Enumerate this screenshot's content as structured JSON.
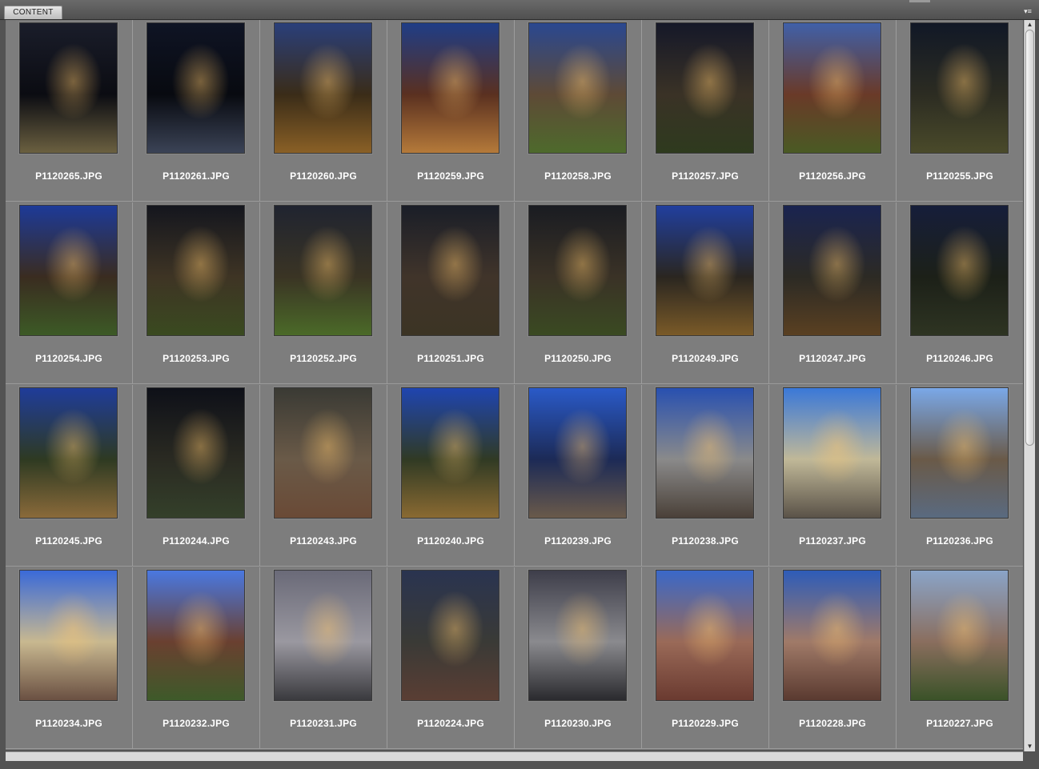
{
  "panel": {
    "tab_label": "CONTENT",
    "menu_icon": "panel-menu-icon"
  },
  "rows": [
    [
      {
        "name": "P1120265.JPG",
        "palette": [
          "#1a1d2a",
          "#0b0c12",
          "#6b6040"
        ]
      },
      {
        "name": "P1120261.JPG",
        "palette": [
          "#0f1424",
          "#080a10",
          "#3b4356"
        ]
      },
      {
        "name": "P1120260.JPG",
        "palette": [
          "#2a3f7a",
          "#3a2c18",
          "#8a6026"
        ]
      },
      {
        "name": "P1120259.JPG",
        "palette": [
          "#1f3d86",
          "#5a3020",
          "#b57a3a"
        ]
      },
      {
        "name": "P1120258.JPG",
        "palette": [
          "#2a4890",
          "#5e4a36",
          "#4e6a2c"
        ]
      },
      {
        "name": "P1120257.JPG",
        "palette": [
          "#151828",
          "#3a3226",
          "#2e3a1e"
        ]
      },
      {
        "name": "P1120256.JPG",
        "palette": [
          "#4060a8",
          "#6a3a28",
          "#4a5a24"
        ]
      },
      {
        "name": "P1120255.JPG",
        "palette": [
          "#111826",
          "#2c2c22",
          "#4a4a2a"
        ]
      }
    ],
    [
      {
        "name": "P1120254.JPG",
        "palette": [
          "#1d3a98",
          "#3a2c20",
          "#3c5a26"
        ]
      },
      {
        "name": "P1120253.JPG",
        "palette": [
          "#14161e",
          "#3e3424",
          "#3a4a20"
        ]
      },
      {
        "name": "P1120252.JPG",
        "palette": [
          "#202430",
          "#3a3424",
          "#4b6a28"
        ]
      },
      {
        "name": "P1120251.JPG",
        "palette": [
          "#1a1e28",
          "#40342a",
          "#3c3424"
        ]
      },
      {
        "name": "P1120250.JPG",
        "palette": [
          "#1a1c22",
          "#3a3226",
          "#3a4a22"
        ]
      },
      {
        "name": "P1120249.JPG",
        "palette": [
          "#213f9e",
          "#2a2620",
          "#7a5a28"
        ]
      },
      {
        "name": "P1120247.JPG",
        "palette": [
          "#1a2450",
          "#2c2a24",
          "#5a4022"
        ]
      },
      {
        "name": "P1120246.JPG",
        "palette": [
          "#161e3a",
          "#1c2018",
          "#2e3422"
        ]
      }
    ],
    [
      {
        "name": "P1120245.JPG",
        "palette": [
          "#1f3c9a",
          "#2e3a22",
          "#8a6a3a"
        ]
      },
      {
        "name": "P1120244.JPG",
        "palette": [
          "#0e1018",
          "#2a2a22",
          "#34402a"
        ]
      },
      {
        "name": "P1120243.JPG",
        "palette": [
          "#3a3a34",
          "#6a5a48",
          "#6a4a36"
        ]
      },
      {
        "name": "P1120240.JPG",
        "palette": [
          "#1f45b0",
          "#303a24",
          "#8a6a32"
        ]
      },
      {
        "name": "P1120239.JPG",
        "palette": [
          "#2a5ac8",
          "#1c2a56",
          "#6a5a4a"
        ]
      },
      {
        "name": "P1120238.JPG",
        "palette": [
          "#2850b0",
          "#8a8a8a",
          "#4a4038"
        ]
      },
      {
        "name": "P1120237.JPG",
        "palette": [
          "#3a78d8",
          "#c0b898",
          "#5a5248"
        ]
      },
      {
        "name": "P1120236.JPG",
        "palette": [
          "#7aa8e8",
          "#6a5a48",
          "#5a6a80"
        ]
      }
    ],
    [
      {
        "name": "P1120234.JPG",
        "palette": [
          "#3a6ad8",
          "#c8b890",
          "#6a5042"
        ]
      },
      {
        "name": "P1120232.JPG",
        "palette": [
          "#4a78e0",
          "#6a4030",
          "#3e5a2a"
        ]
      },
      {
        "name": "P1120231.JPG",
        "palette": [
          "#6a6a78",
          "#9a98a0",
          "#3a3a3e"
        ]
      },
      {
        "name": "P1120224.JPG",
        "palette": [
          "#2a3450",
          "#3a3a36",
          "#5a3e34"
        ]
      },
      {
        "name": "P1120230.JPG",
        "palette": [
          "#3e3e4a",
          "#8a8a8e",
          "#2a2a2e"
        ]
      },
      {
        "name": "P1120229.JPG",
        "palette": [
          "#3a68c8",
          "#9a6a58",
          "#6a3a30"
        ]
      },
      {
        "name": "P1120228.JPG",
        "palette": [
          "#2e5cb8",
          "#a07a68",
          "#5a3a30"
        ]
      },
      {
        "name": "P1120227.JPG",
        "palette": [
          "#8aa4c8",
          "#8a6e5e",
          "#3a5228"
        ]
      }
    ]
  ]
}
